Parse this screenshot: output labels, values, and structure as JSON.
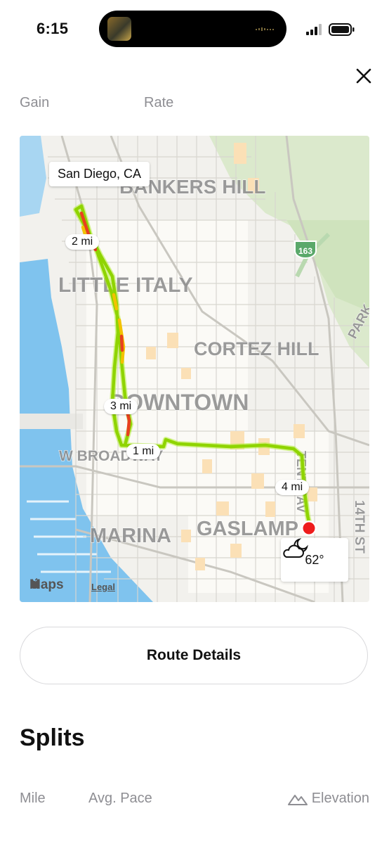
{
  "status_bar": {
    "time": "6:15"
  },
  "top": {
    "close_icon": "close-icon"
  },
  "stats_columns": [
    "Gain",
    "Rate"
  ],
  "map": {
    "location_label": "San Diego, CA",
    "neighborhoods": [
      "BANKERS HILL",
      "LITTLE ITALY",
      "CORTEZ HILL",
      "DOWNTOWN",
      "W BROADWAY",
      "MARINA",
      "GASLAMP",
      "TENTH AV",
      "14TH ST",
      "PARK"
    ],
    "highway_shield": "163",
    "mile_markers": [
      "1 mi",
      "2 mi",
      "3 mi",
      "4 mi"
    ],
    "weather": {
      "temperature": "62°",
      "icon": "partly-cloudy-night-icon"
    },
    "attribution": {
      "brand": "Maps",
      "legal": "Legal"
    },
    "route_colors": {
      "fast": "#8fd400",
      "mid": "#f2c200",
      "slow": "#e8401f"
    }
  },
  "route_details_label": "Route Details",
  "splits": {
    "title": "Splits",
    "columns": [
      "Mile",
      "Avg. Pace",
      "Elevation"
    ]
  }
}
